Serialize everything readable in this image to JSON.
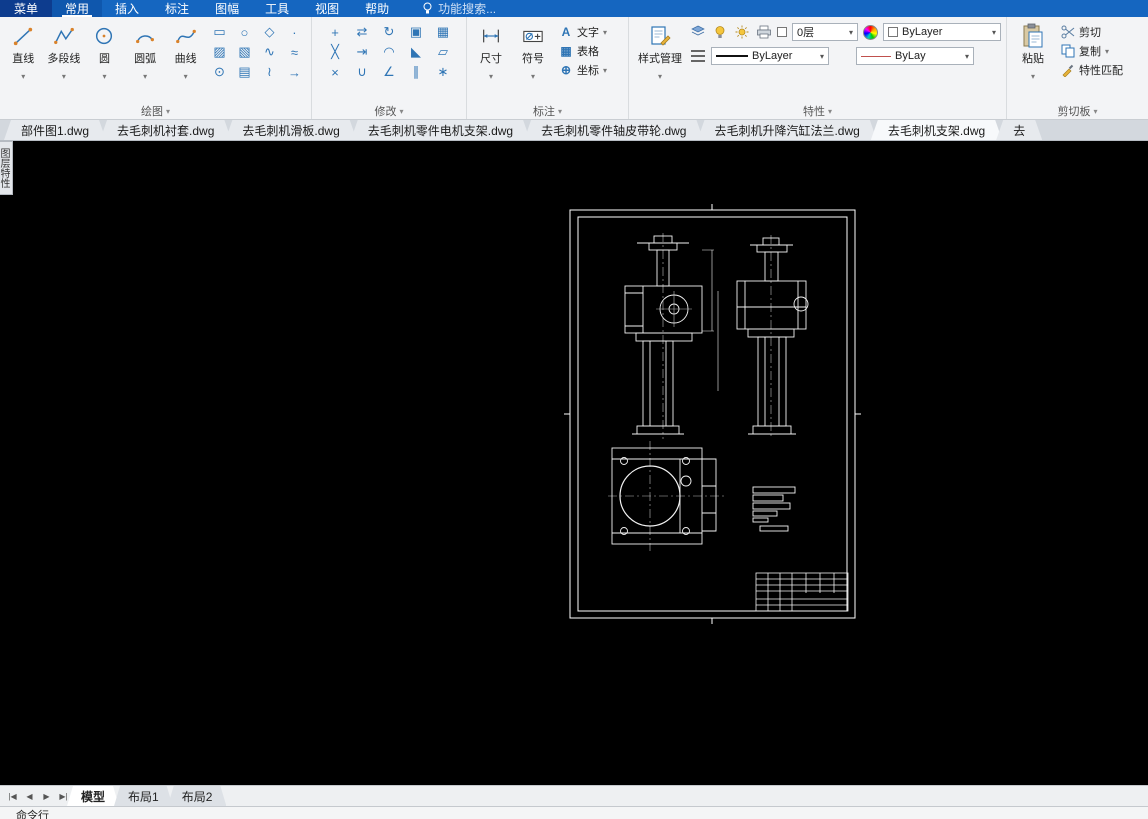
{
  "menu": {
    "app_button": "菜单",
    "tabs": [
      {
        "label": "常用"
      },
      {
        "label": "插入"
      },
      {
        "label": "标注"
      },
      {
        "label": "图幅"
      },
      {
        "label": "工具"
      },
      {
        "label": "视图"
      },
      {
        "label": "帮助"
      }
    ],
    "search": {
      "placeholder": "功能搜索..."
    }
  },
  "ribbon": {
    "draw": {
      "label": "绘图",
      "tools": [
        {
          "label": "直线"
        },
        {
          "label": "多段线"
        },
        {
          "label": "圆"
        },
        {
          "label": "圆弧"
        },
        {
          "label": "曲线"
        }
      ],
      "extra_glyphs": [
        "▭",
        "○",
        "◇",
        "·",
        "▨",
        "▧",
        "∿",
        "≈",
        "⊙",
        "▤",
        "≀",
        "→"
      ]
    },
    "modify": {
      "label": "修改",
      "glyphs": [
        "+",
        "⇄",
        "↻",
        "▣",
        "▦",
        "╳",
        "⇥",
        "◠",
        "◣",
        "▱",
        "×",
        "∪",
        "∠",
        "∥",
        "∗"
      ]
    },
    "annotate": {
      "label": "标注",
      "dimension": "尺寸",
      "symbol": "符号",
      "text": "文字",
      "table": "表格",
      "coordinate": "坐标",
      "text_icon": "A",
      "table_icon": "▦",
      "coordinate_icon": "⊕"
    },
    "properties": {
      "label": "特性",
      "style_manager": "样式管理",
      "layer_value": "0层",
      "color_value": "ByLayer",
      "lineweight_value": "ByLayer",
      "linetype_value": "ByLay"
    },
    "clipboard": {
      "label": "剪切板",
      "paste": "粘贴",
      "cut": "剪切",
      "copy": "复制",
      "match": "特性匹配"
    }
  },
  "document_tabs": [
    {
      "label": "部件图1.dwg"
    },
    {
      "label": "去毛刺机衬套.dwg"
    },
    {
      "label": "去毛刺机滑板.dwg"
    },
    {
      "label": "去毛刺机零件电机支架.dwg"
    },
    {
      "label": "去毛刺机零件轴皮带轮.dwg"
    },
    {
      "label": "去毛刺机升降汽缸法兰.dwg"
    },
    {
      "label": "去毛刺机支架.dwg"
    },
    {
      "label": "去"
    }
  ],
  "left_palette": {
    "label": "图层特性"
  },
  "layout_bar": {
    "nav": [
      "|◀",
      "◀",
      "▶",
      "▶|"
    ],
    "tabs": [
      {
        "label": "模型"
      },
      {
        "label": "布局1"
      },
      {
        "label": "布局2"
      }
    ]
  },
  "command_panel": {
    "title": "命令行"
  }
}
